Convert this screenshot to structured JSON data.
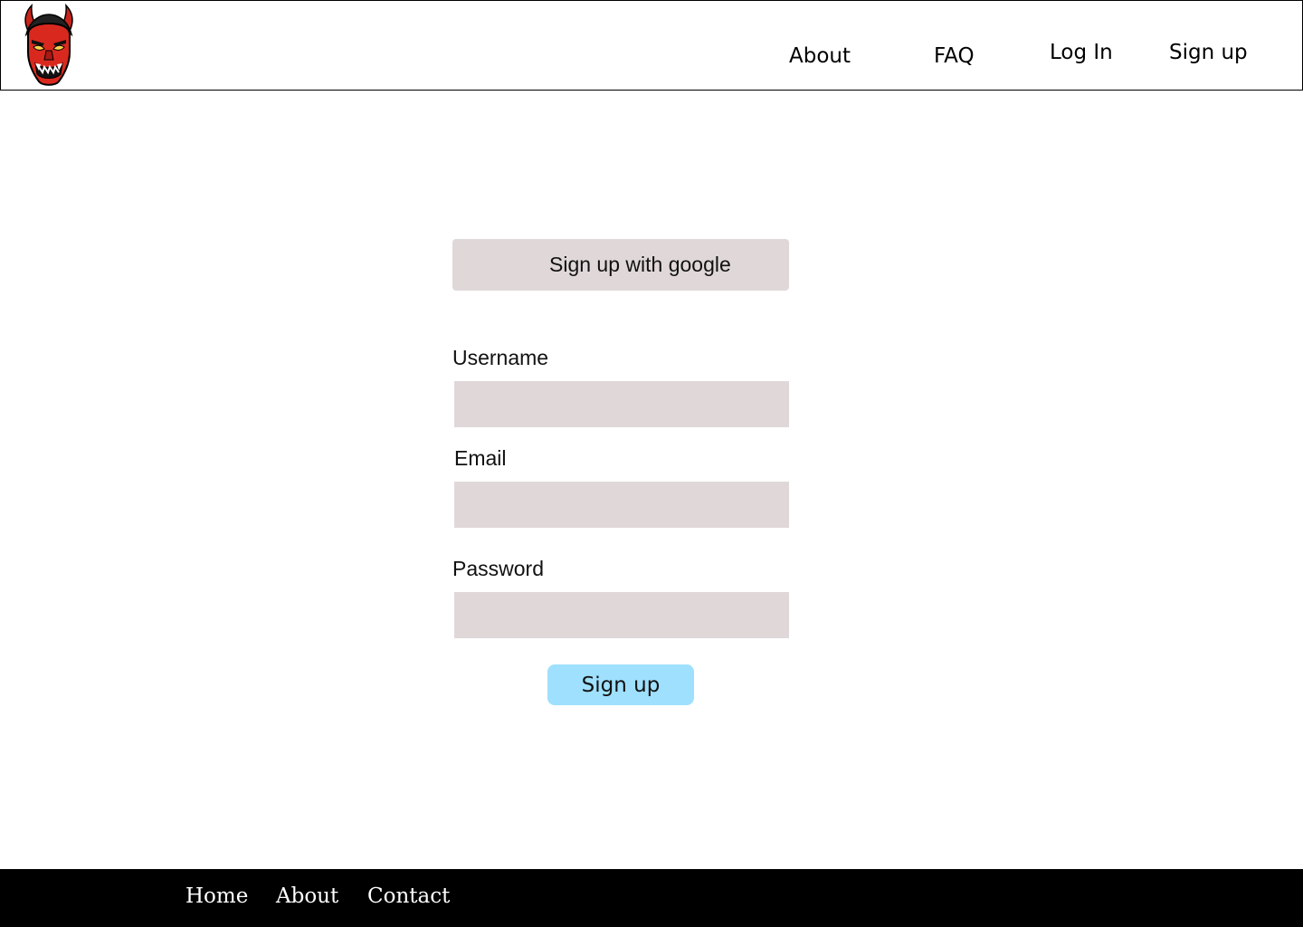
{
  "header": {
    "logo_icon": "oni-mask-logo",
    "nav": {
      "about": "About",
      "faq": "FAQ",
      "login": "Log In",
      "signup": "Sign up"
    }
  },
  "form": {
    "google_button": "Sign up with google",
    "username_label": "Username",
    "username_value": "",
    "email_label": "Email",
    "email_value": "",
    "password_label": "Password",
    "password_value": "",
    "submit_label": "Sign up"
  },
  "footer": {
    "links": [
      "Home",
      "About",
      "Contact"
    ]
  },
  "colors": {
    "input_bg": "#e0d8d8",
    "submit_bg": "#9ee0fd",
    "footer_bg": "#000000",
    "logo_red": "#d9291f"
  }
}
